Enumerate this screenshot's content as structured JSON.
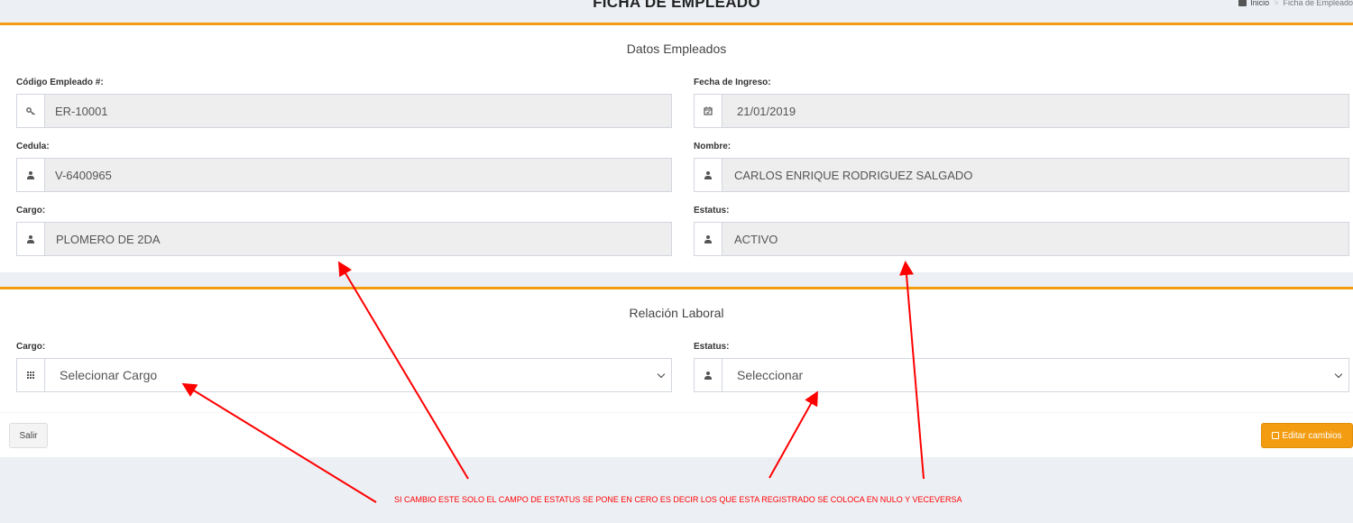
{
  "header": {
    "title": "FICHA DE EMPLEADO",
    "breadcrumb": [
      "Inicio",
      "Ficha de Empleado"
    ]
  },
  "datos": {
    "title": "Datos Empleados",
    "codigo": {
      "label": "Código Empleado #:",
      "value": "ER-10001",
      "icon": "key-icon"
    },
    "fecha": {
      "label": "Fecha de Ingreso:",
      "value": "21/01/2019",
      "icon": "calendar-icon"
    },
    "cedula": {
      "label": "Cedula:",
      "value": "V-6400965",
      "icon": "user-icon"
    },
    "nombre": {
      "label": "Nombre:",
      "value": "CARLOS ENRIQUE RODRIGUEZ SALGADO",
      "icon": "user-icon"
    },
    "cargo": {
      "label": "Cargo:",
      "value": "PLOMERO DE 2DA",
      "icon": "user-icon"
    },
    "estatus": {
      "label": "Estatus:",
      "value": "ACTIVO",
      "icon": "user-icon"
    }
  },
  "relacion": {
    "title": "Relación Laboral",
    "cargo": {
      "label": "Cargo:",
      "value": "Selecionar Cargo",
      "icon": "grid-icon"
    },
    "estatus": {
      "label": "Estatus:",
      "value": "Seleccionar",
      "icon": "user-icon"
    }
  },
  "actions": {
    "salir": "Salir",
    "editar": "Editar cambios"
  },
  "annotation": "SI CAMBIO ESTE SOLO  EL CAMPO DE ESTATUS SE PONE EN CERO ES DECIR LOS QUE ESTA REGISTRADO SE COLOCA EN NULO Y VECEVERSA",
  "colors": {
    "accent": "#f39c12",
    "annotation": "#ff0000"
  }
}
